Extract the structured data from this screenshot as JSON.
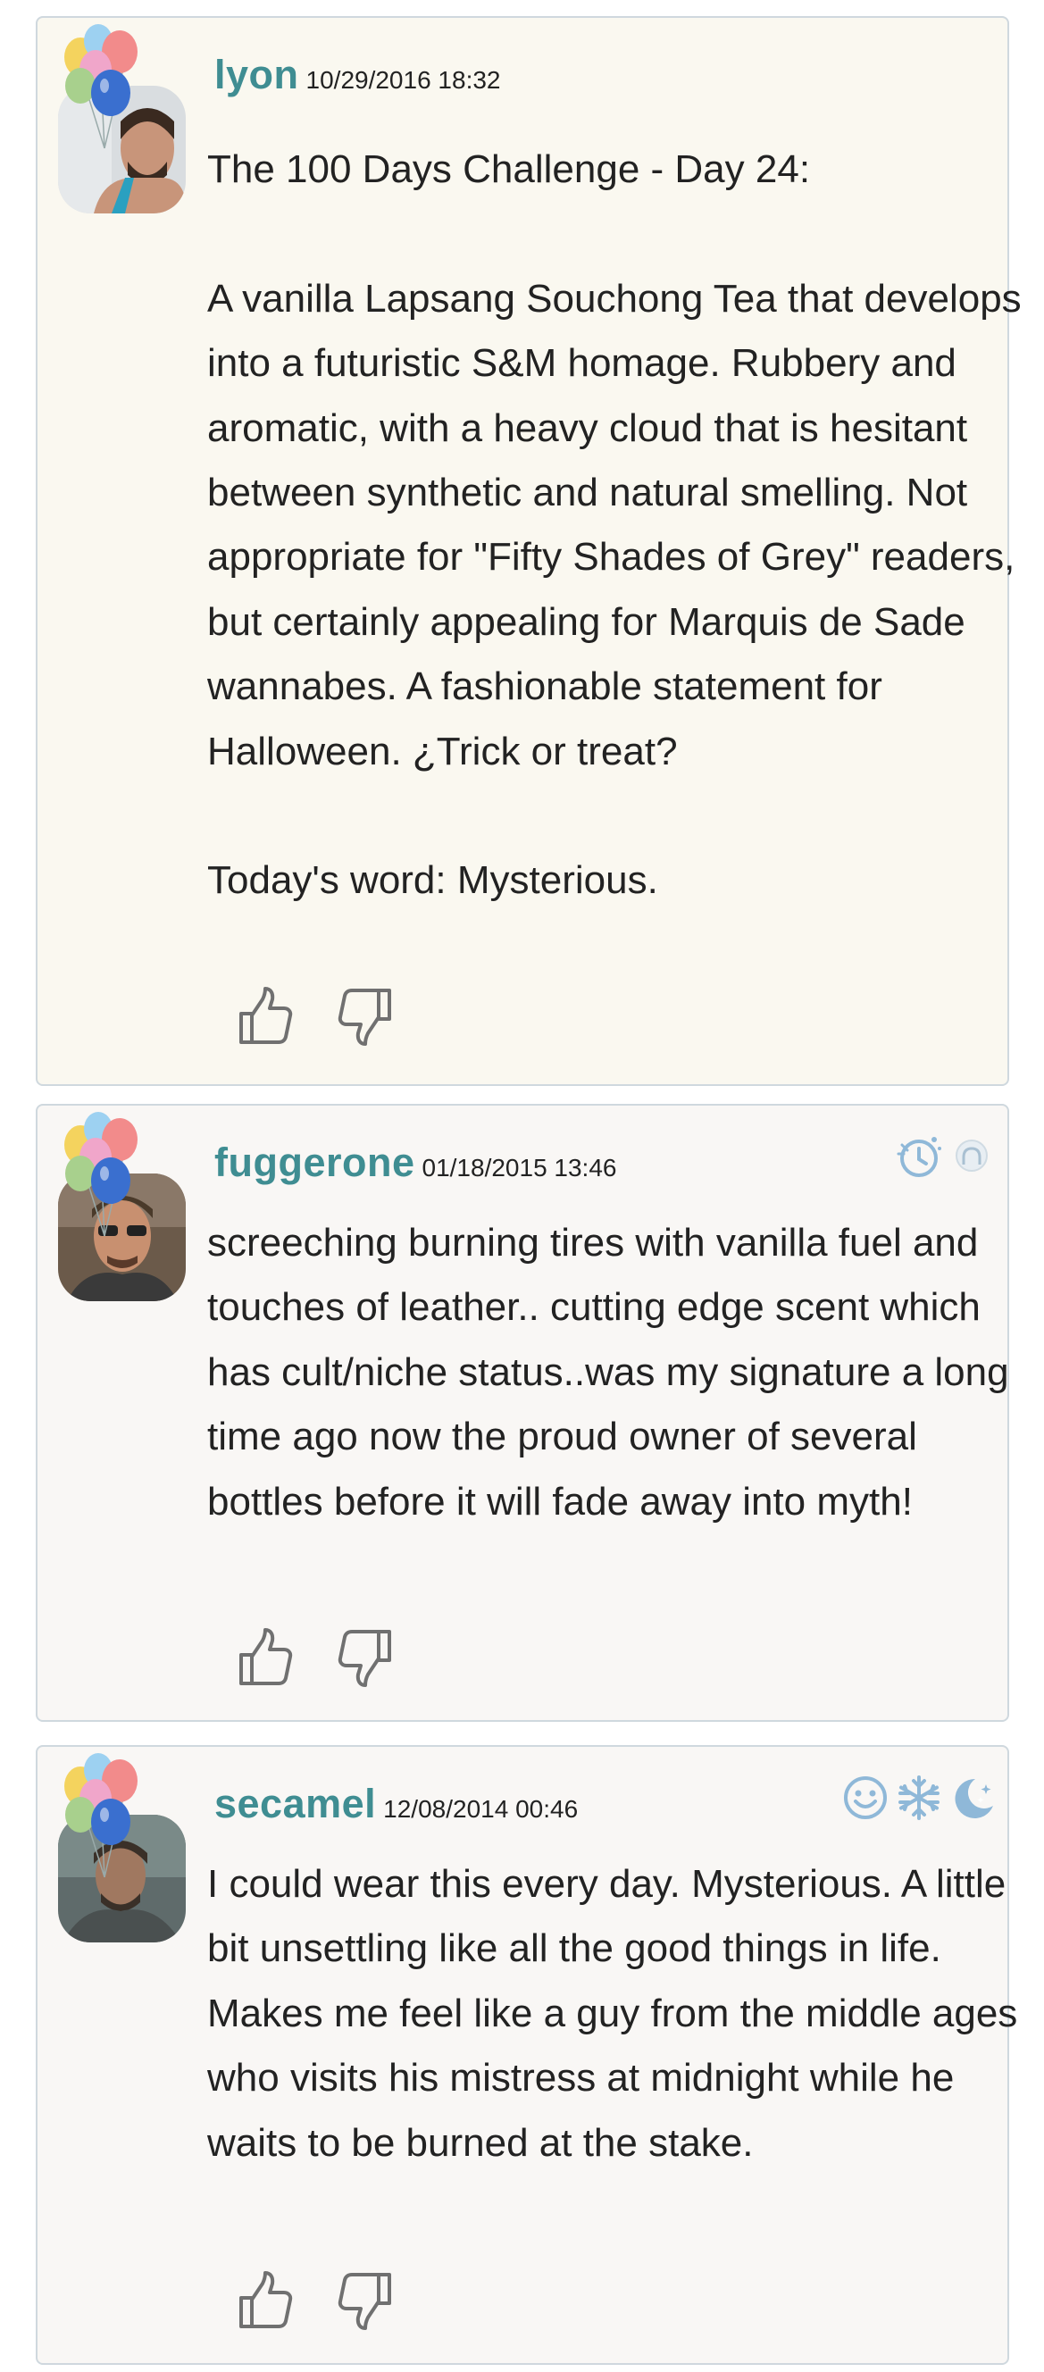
{
  "colors": {
    "username": "#3f8d92",
    "card_cream": "#faf8f0",
    "card_light": "#f9f7f5",
    "border": "#cfd8de",
    "badge_blue": "#8fb8d8",
    "thumb_gray": "#707070"
  },
  "reviews": [
    {
      "username": "lyon",
      "timestamp": "10/29/2016 18:32",
      "text": "The 100 Days Challenge - Day 24:\n\nA vanilla Lapsang Souchong Tea that develops into a futuristic S&M homage. Rubbery and aromatic, with a heavy cloud that is hesitant between synthetic and natural smelling. Not appropriate for \"Fifty Shades of Grey\" readers, but certainly appealing for Marquis de Sade wannabes. A fashionable statement for Halloween. ¿Trick or treat?\n\nToday's word: Mysterious.",
      "badges": []
    },
    {
      "username": "fuggerone",
      "timestamp": "01/18/2015 13:46",
      "text": "screeching burning tires with vanilla fuel and touches of leather.. cutting edge scent which has cult/niche status..was my signature a long time ago now the proud owner of several bottles before it will fade away into myth!",
      "badges": [
        "clock-icon",
        "user-silhouette-icon"
      ]
    },
    {
      "username": "secamel",
      "timestamp": "12/08/2014 00:46",
      "text": "I could wear this every day. Mysterious. A little bit unsettling like all the good things in life. Makes me feel like a guy from the middle ages who visits his mistress at midnight while he waits to be burned at the stake.",
      "badges": [
        "smiley-icon",
        "snowflake-icon",
        "moon-icon"
      ]
    }
  ],
  "icons": {
    "like": "thumbs-up-icon",
    "dislike": "thumbs-down-icon",
    "decoration": "balloons-icon"
  }
}
